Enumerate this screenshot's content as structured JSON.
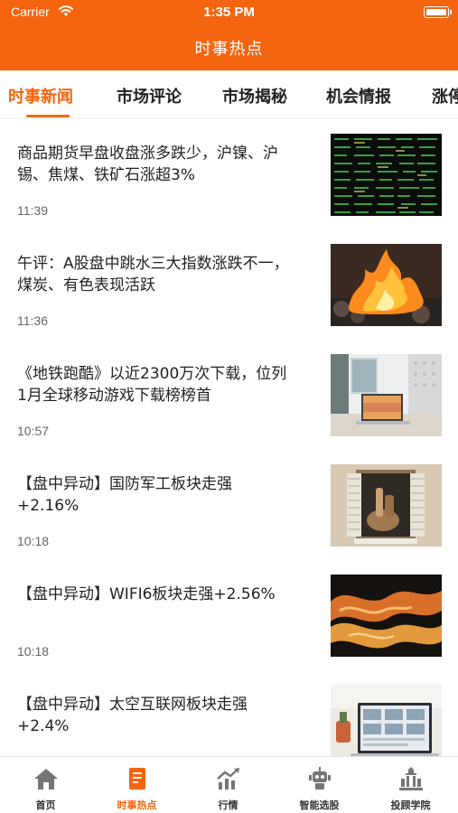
{
  "status_bar": {
    "carrier": "Carrier",
    "time": "1:35 PM"
  },
  "header": {
    "title": "时事热点"
  },
  "tabs": [
    {
      "label": "时事新闻",
      "active": true
    },
    {
      "label": "市场评论",
      "active": false
    },
    {
      "label": "市场揭秘",
      "active": false
    },
    {
      "label": "机会情报",
      "active": false
    },
    {
      "label": "涨停",
      "active": false
    }
  ],
  "news": [
    {
      "title": "商品期货早盘收盘涨多跌少，沪镍、沪锡、焦煤、铁矿石涨超3%",
      "time": "11:39",
      "thumb": "stock-board"
    },
    {
      "title": "午评：A股盘中跳水三大指数涨跌不一，煤炭、有色表现活跃",
      "time": "11:36",
      "thumb": "fire"
    },
    {
      "title": "《地铁跑酷》以近2300万次下载，位列1月全球移动游戏下载榜榜首",
      "time": "10:57",
      "thumb": "laptop-desk"
    },
    {
      "title": "【盘中异动】国防军工板块走强+2.16%",
      "time": "10:18",
      "thumb": "window-shutters"
    },
    {
      "title": "【盘中异动】WIFI6板块走强+2.56%",
      "time": "10:18",
      "thumb": "abstract-orange"
    },
    {
      "title": "【盘中异动】太空互联网板块走强+2.4%",
      "time": "",
      "thumb": "laptop-screen"
    }
  ],
  "bottom_nav": [
    {
      "label": "首页",
      "icon": "home-icon",
      "active": false
    },
    {
      "label": "时事热点",
      "icon": "news-icon",
      "active": true
    },
    {
      "label": "行情",
      "icon": "chart-icon",
      "active": false
    },
    {
      "label": "智能选股",
      "icon": "robot-icon",
      "active": false
    },
    {
      "label": "投顾学院",
      "icon": "building-icon",
      "active": false
    }
  ],
  "colors": {
    "accent": "#f5650f",
    "text": "#222222",
    "muted": "#666666"
  }
}
